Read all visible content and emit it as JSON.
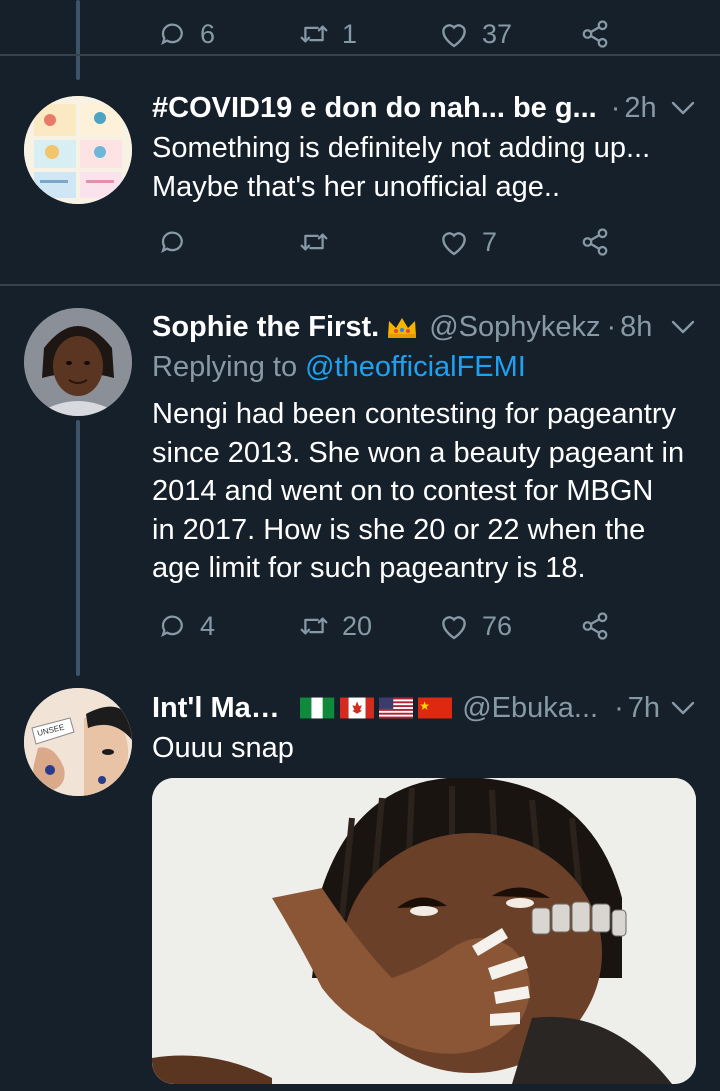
{
  "tweets": [
    {
      "id": "top",
      "actions": {
        "reply": "6",
        "retweet": "1",
        "like": "37"
      }
    },
    {
      "id": "covid",
      "name": "#COVID19 e don do nah... be g...",
      "time": "2h",
      "text_lines": [
        "Something is definitely not adding up...",
        "Maybe that's her unofficial age.."
      ],
      "actions": {
        "reply": "",
        "retweet": "",
        "like": "7"
      },
      "avatar_icon": "covid-infographic-avatar"
    },
    {
      "id": "sophie",
      "name": "Sophie the First.",
      "name_badge_icon": "crown-icon",
      "handle": "@Sophykekz",
      "time": "8h",
      "replying_prefix": "Replying to",
      "replying_mention": "@theofficialFEMI",
      "text_lines": [
        "Nengi had been contesting for pageantry",
        "since 2013. She won a beauty pageant in",
        "2014 and went on to contest for MBGN",
        "in 2017. How is she 20 or 22 when the",
        "age limit for such pageantry is 18."
      ],
      "actions": {
        "reply": "4",
        "retweet": "20",
        "like": "76"
      }
    },
    {
      "id": "intl",
      "name": "Int'l Man™",
      "flags": [
        "nigeria-flag-icon",
        "canada-flag-icon",
        "usa-flag-icon",
        "china-flag-icon"
      ],
      "handle": "@Ebuka...",
      "time": "7h",
      "text": "Ouuu snap",
      "avatar_text": "UNSEE",
      "media": "gif-woman-covering-mouth"
    }
  ],
  "separator_dot": "·",
  "colors": {
    "background": "#15202b",
    "divider": "#38444d",
    "secondary_text": "#8899a6",
    "link": "#1da1f2",
    "thread_line": "#3d5466"
  }
}
